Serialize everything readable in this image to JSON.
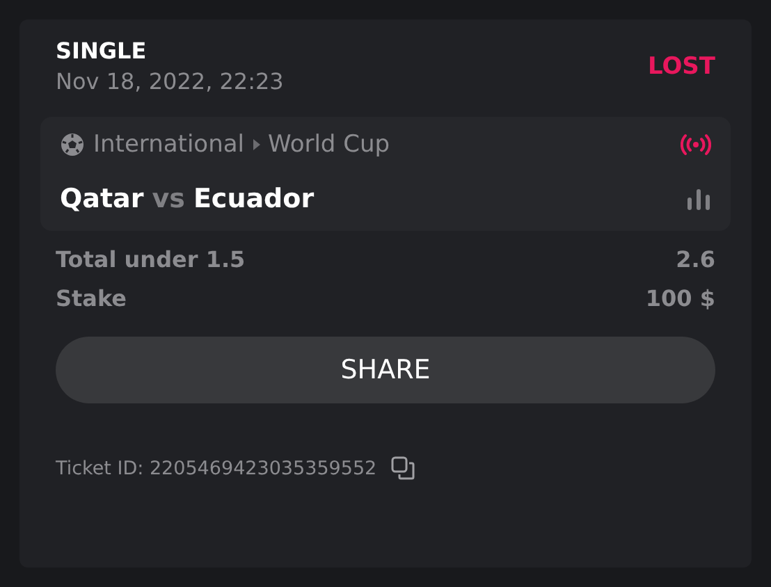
{
  "bet_type": "SINGLE",
  "date": "Nov 18, 2022, 22:23",
  "result": "LOST",
  "event": {
    "category": "International",
    "league": "World Cup",
    "live": true,
    "home": "Qatar",
    "vs": "vs",
    "away": "Ecuador"
  },
  "rows": [
    {
      "label": "Total under 1.5",
      "value": "2.6"
    },
    {
      "label": "Stake",
      "value": "100 $"
    }
  ],
  "share_button": "SHARE",
  "ticket_id": "Ticket ID: 2205469423035359552"
}
